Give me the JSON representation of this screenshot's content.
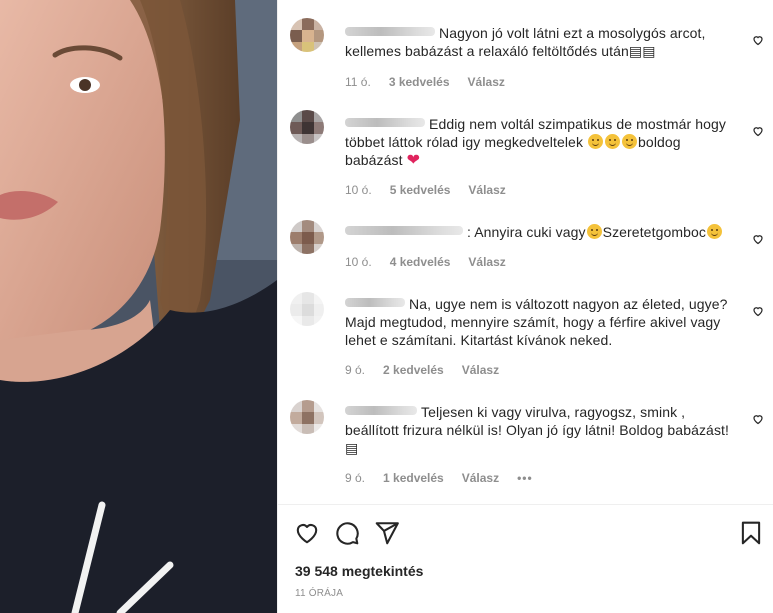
{
  "comments": [
    {
      "text": "Nagyon jó volt látni ezt a mosolygós arcot, kellemes babázást a relaxáló feltöltődés után▤▤",
      "time": "11 ó.",
      "likes": "3 kedvelés",
      "reply": "Válasz"
    },
    {
      "text_a": "Eddig nem voltál szimpatikus de mostmár hogy többet láttok rólad igy megkedveltelek ",
      "text_b": "boldog babázást ",
      "heart": "❤",
      "time": "10 ó.",
      "likes": "5 kedvelés",
      "reply": "Válasz"
    },
    {
      "text_a": ": Annyira cuki vagy",
      "text_b": "Szeretetgomboc",
      "time": "10 ó.",
      "likes": "4 kedvelés",
      "reply": "Válasz"
    },
    {
      "text": "Na, ugye nem is változott nagyon az életed, ugye? Majd megtudod, mennyire számít, hogy a férfire akivel vagy lehet e számítani. Kitartást kívánok neked.",
      "time": "9 ó.",
      "likes": "2 kedvelés",
      "reply": "Válasz"
    },
    {
      "text": "Teljesen ki vagy virulva, ragyogsz, smink , beállított frizura nélkül is! Olyan jó így látni! Boldog babázást!▤",
      "time": "9 ó.",
      "likes": "1 kedvelés",
      "reply": "Válasz",
      "more": "•••"
    }
  ],
  "post": {
    "views": "39 548 megtekintés",
    "ago": "11 ÓRÁJA"
  },
  "icons": [
    "heart-icon",
    "comment-icon",
    "share-icon",
    "bookmark-icon"
  ],
  "colors": {
    "text": "#262626",
    "muted": "#8e8e8e",
    "heart": "#e0245e",
    "divider": "#efefef"
  }
}
